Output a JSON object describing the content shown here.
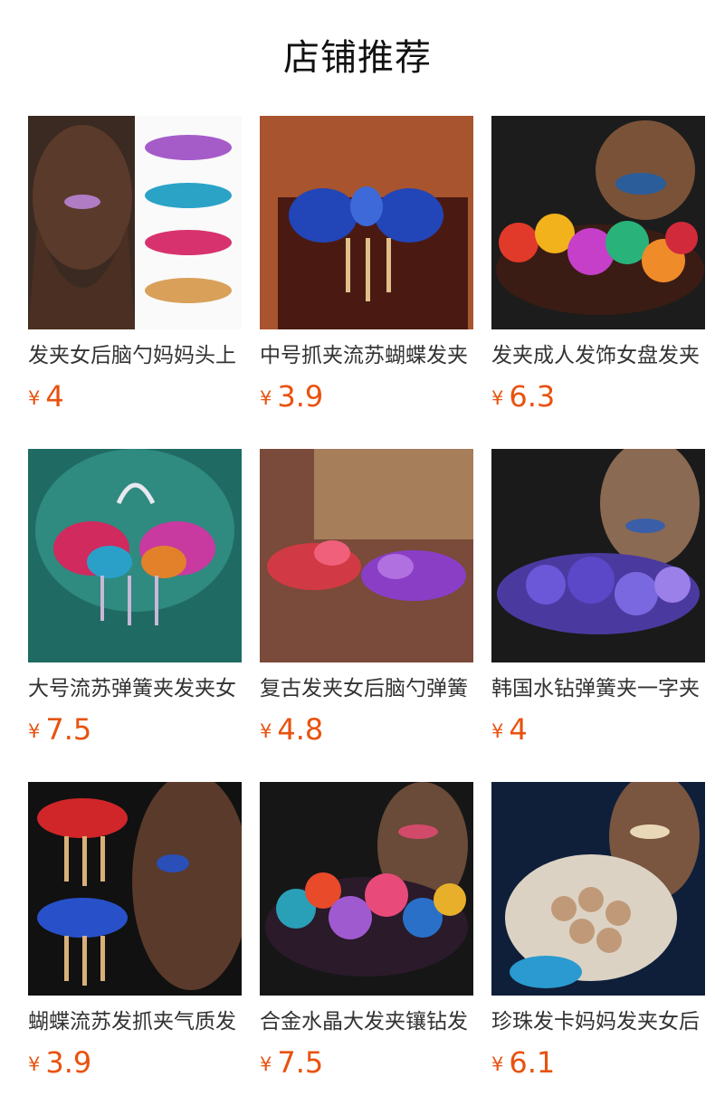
{
  "header": {
    "title": "店铺推荐"
  },
  "currency_symbol": "¥",
  "products": [
    {
      "title": "发夹女后脑勺妈妈头上",
      "price": "4",
      "image": "hair-clip-photo-1"
    },
    {
      "title": "中号抓夹流苏蝴蝶发夹",
      "price": "3.9",
      "image": "hair-clip-photo-2"
    },
    {
      "title": "发夹成人发饰女盘发夹",
      "price": "6.3",
      "image": "hair-clip-photo-3"
    },
    {
      "title": "大号流苏弹簧夹发夹女",
      "price": "7.5",
      "image": "hair-clip-photo-4"
    },
    {
      "title": "复古发夹女后脑勺弹簧",
      "price": "4.8",
      "image": "hair-clip-photo-5"
    },
    {
      "title": "韩国水钻弹簧夹一字夹",
      "price": "4",
      "image": "hair-clip-photo-6"
    },
    {
      "title": "蝴蝶流苏发抓夹气质发",
      "price": "3.9",
      "image": "hair-clip-photo-7"
    },
    {
      "title": "合金水晶大发夹镶钻发",
      "price": "7.5",
      "image": "hair-clip-photo-8"
    },
    {
      "title": "珍珠发卡妈妈发夹女后",
      "price": "6.1",
      "image": "hair-clip-photo-9"
    }
  ]
}
